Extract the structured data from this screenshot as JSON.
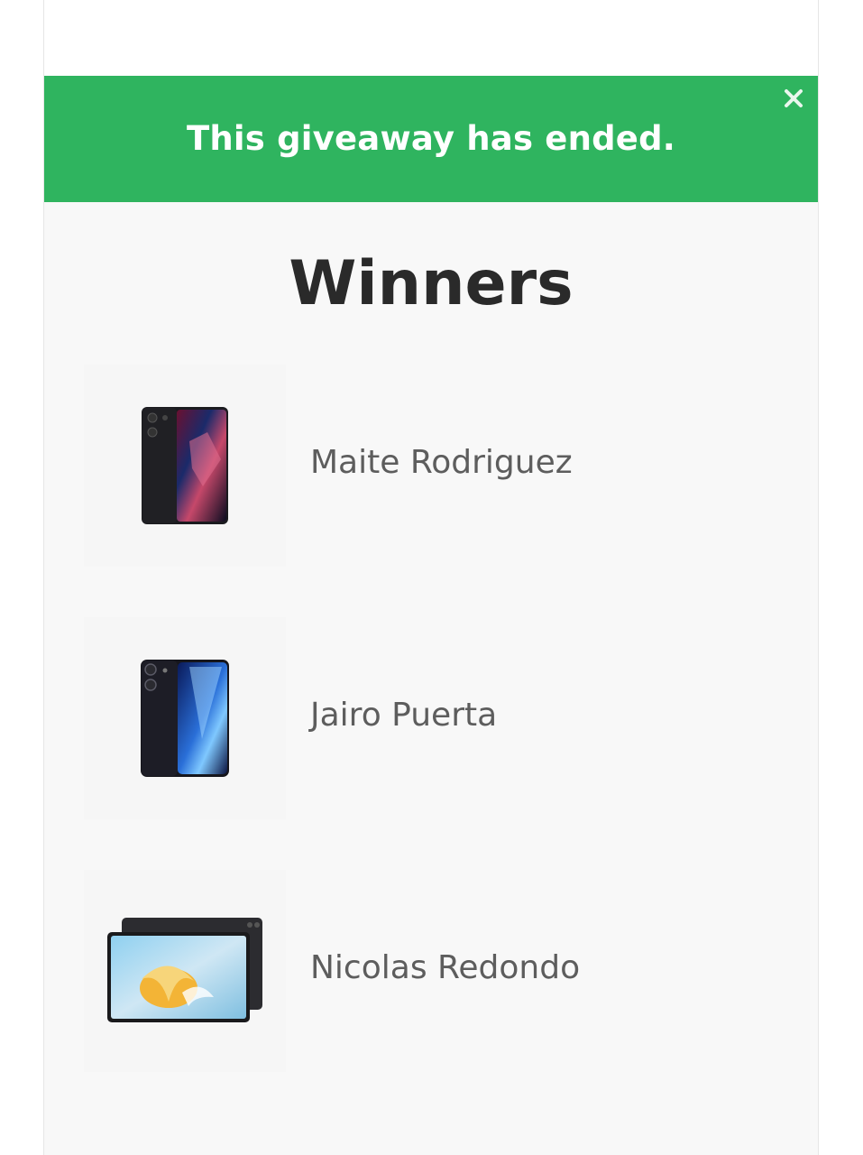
{
  "banner": {
    "message": "This giveaway has ended.",
    "close_icon": "close-icon",
    "color": "#2fb45f"
  },
  "winners": {
    "title": "Winners",
    "items": [
      {
        "name": "Maite Rodriguez",
        "prize_icon": "smartphone-image"
      },
      {
        "name": "Jairo Puerta",
        "prize_icon": "smartphone-image"
      },
      {
        "name": "Nicolas Redondo",
        "prize_icon": "tablet-image"
      }
    ]
  }
}
